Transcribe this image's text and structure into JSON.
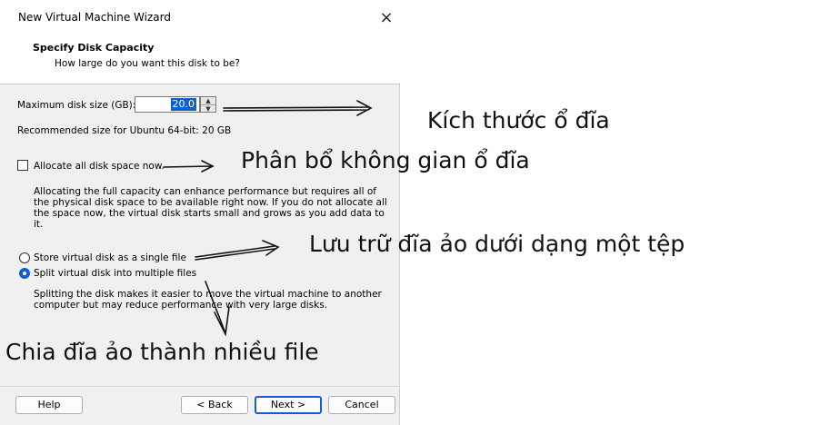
{
  "window": {
    "title": "New Virtual Machine Wizard",
    "close_glyph": "×"
  },
  "header": {
    "title": "Specify Disk Capacity",
    "subtitle": "How large do you want this disk to be?"
  },
  "disk": {
    "size_label": "Maximum disk size (GB):",
    "size_value": "20.0",
    "recommended": "Recommended size for Ubuntu 64-bit: 20 GB"
  },
  "allocate": {
    "label": "Allocate all disk space now.",
    "checked": false,
    "description": "Allocating the full capacity can enhance performance but requires all of the physical disk space to be available right now. If you do not allocate all the space now, the virtual disk starts small and grows as you add data to it."
  },
  "storage_options": [
    {
      "label": "Store virtual disk as a single file",
      "selected": false
    },
    {
      "label": "Split virtual disk into multiple files",
      "selected": true
    }
  ],
  "split_description": "Splitting the disk makes it easier to move the virtual machine to another computer but may reduce performance with very large disks.",
  "buttons": {
    "help": "Help",
    "back": "< Back",
    "next": "Next >",
    "cancel": "Cancel"
  },
  "annotations": {
    "disk_size": "Kích thước ổ đĩa",
    "allocate": "Phân bổ không gian ổ đĩa",
    "single_file": "Lưu trữ đĩa ảo dưới dạng một tệp",
    "split": "Chia đĩa ảo thành nhiều file"
  },
  "colors": {
    "accent": "#0f5fd0",
    "dialog_bg": "#f0f0f0"
  }
}
